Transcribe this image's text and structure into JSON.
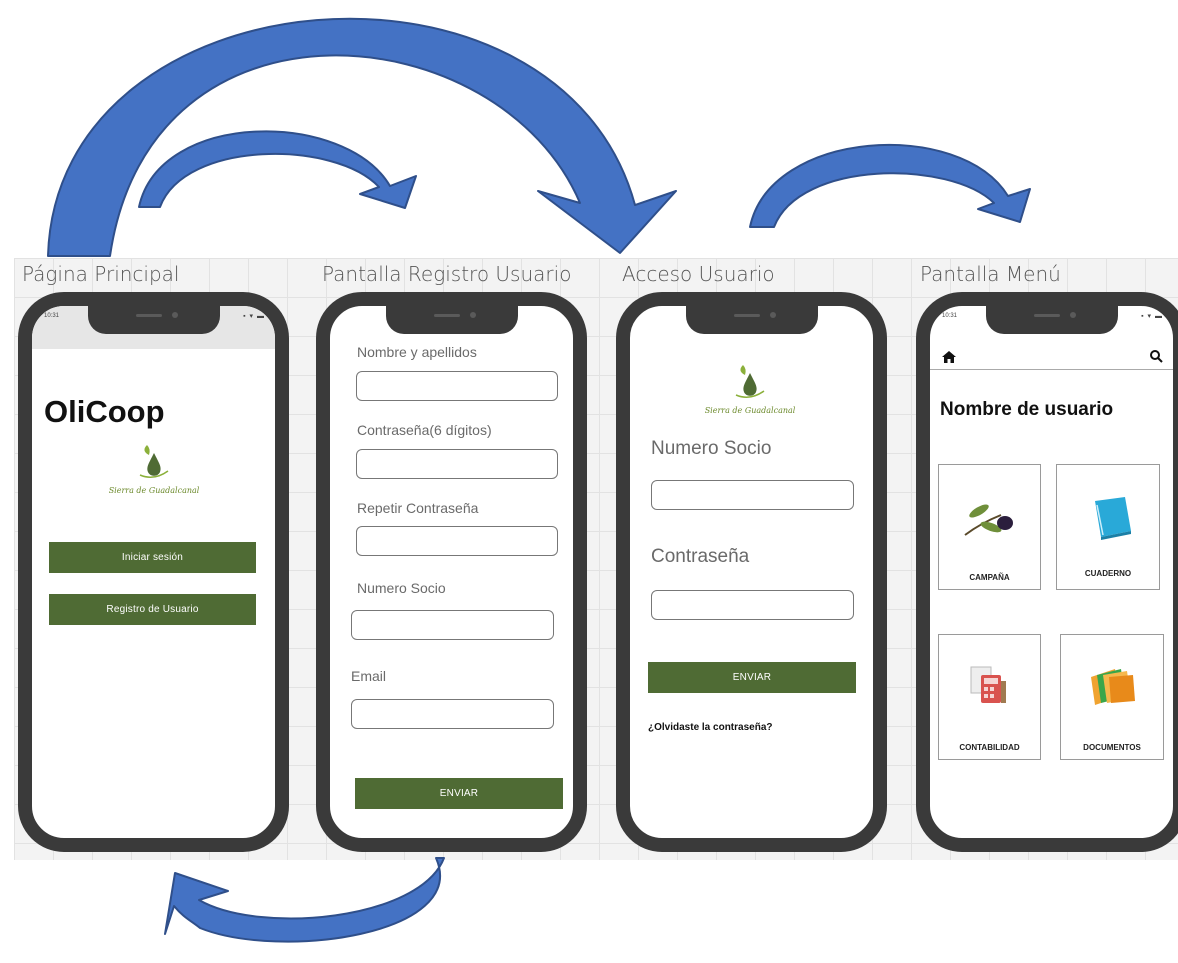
{
  "screens": [
    {
      "title": "Página Principal"
    },
    {
      "title": "Pantalla Registro Usuario"
    },
    {
      "title": "Acceso Usuario"
    },
    {
      "title": "Pantalla Menú"
    }
  ],
  "home": {
    "status_time": "10:31",
    "status_icons": "▪ ▾ ▬",
    "app_name": "OliCoop",
    "logo_text": "Sierra de Guadalcanal",
    "login_button": "Iniciar sesión",
    "register_button": "Registro de Usuario"
  },
  "register": {
    "fields": [
      {
        "label": "Nombre y apellidos"
      },
      {
        "label": "Contraseña(6 dígitos)"
      },
      {
        "label": "Repetir Contraseña"
      },
      {
        "label": "Numero Socio"
      },
      {
        "label": "Email"
      }
    ],
    "submit": "ENVIAR"
  },
  "login": {
    "logo_text": "Sierra de Guadalcanal",
    "member_label": "Numero Socio",
    "password_label": "Contraseña",
    "submit": "ENVIAR",
    "forgot": "¿Olvidaste la contraseña?"
  },
  "menu": {
    "status_time": "10:31",
    "status_icons": "▪ ▾ ▬",
    "home_icon": "home-icon",
    "search_icon": "search-icon",
    "username": "Nombre de usuario",
    "tiles": [
      {
        "label": "CAMPAÑA",
        "icon": "olive-icon"
      },
      {
        "label": "CUADERNO",
        "icon": "notebook-icon"
      },
      {
        "label": "CONTABILIDAD",
        "icon": "calculator-icon"
      },
      {
        "label": "DOCUMENTOS",
        "icon": "folders-icon"
      }
    ]
  },
  "colors": {
    "button_green": "#4f6b34",
    "arrow_blue": "#4472c4",
    "phone_frame": "#3a3a3a"
  }
}
